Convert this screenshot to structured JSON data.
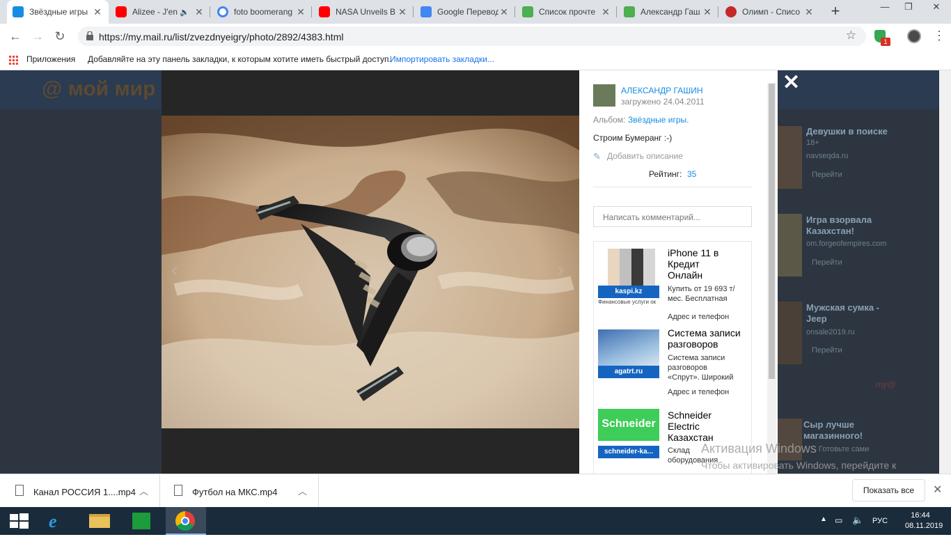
{
  "tabs": [
    {
      "title": "Звёздные игры",
      "favicon": "mail-ru",
      "active": true
    },
    {
      "title": "Alizee - J'en",
      "favicon": "youtube",
      "audio": true
    },
    {
      "title": "foto boomerang",
      "favicon": "google"
    },
    {
      "title": "NASA Unveils B",
      "favicon": "youtube"
    },
    {
      "title": "Google Перевод",
      "favicon": "google-translate"
    },
    {
      "title": "Список прочте",
      "favicon": "green-square"
    },
    {
      "title": "Александр Гаш",
      "favicon": "green-square"
    },
    {
      "title": "Олимп - Списо",
      "favicon": "olimp"
    }
  ],
  "toolbar": {
    "url": "https://my.mail.ru/list/zvezdnyeigry/photo/2892/4383.html",
    "badge": "1"
  },
  "bookmarks": {
    "apps_label": "Приложения",
    "hint": "Добавляйте на эту панель закладки, к которым хотите иметь быстрый доступ.",
    "import_link": "Импортировать закладки..."
  },
  "page": {
    "logo": "@ мой мир",
    "author": "АЛЕКСАНДР ГАШИН",
    "uploaded": "загружено 24.04.2011",
    "album_label": "Альбом:",
    "album_name": "Звёздные игры.",
    "caption": "Строим Бумеранг :-)",
    "add_description": "Добавить описание",
    "rating_label": "Рейтинг:",
    "rating_value": "35",
    "comment_placeholder": "Написать комментарий..."
  },
  "ads": [
    {
      "title": "iPhone 11 в Кредит Онлайн",
      "text": "Купить от 19 693 т/мес. Бесплатная",
      "address": "Адрес и телефон",
      "domain": "kaspi.kz",
      "subtext": "Финансовые услуги ок"
    },
    {
      "title": "Система записи разговоров",
      "text": "Система записи разговоров «Спрут». Широкий",
      "address": "Адрес и телефон",
      "domain": "agatrt.ru"
    },
    {
      "title": "Schneider Electric Казахстан",
      "text": "Склад оборудования",
      "domain": "schneider-ka..."
    }
  ],
  "right_ads": [
    {
      "title": "Девушки в поиске",
      "age": "18+",
      "domain": "navseqda.ru",
      "go": "Перейти"
    },
    {
      "title": "Игра взорвала Казахстан!",
      "domain": "om.forgeofempires.com",
      "go": "Перейти"
    },
    {
      "title": "Мужская сумка - Jeep",
      "domain": "onsale2019.ru",
      "go": "Перейти"
    },
    {
      "title": "Сыр лучше магазинного!",
      "extra": "Готовьте сами"
    }
  ],
  "watermark": {
    "title": "Активация Windows",
    "text": "Чтобы активировать Windows, перейдите к параметрам компьютера."
  },
  "downloads": {
    "items": [
      "Канал РОССИЯ 1....mp4",
      "Футбол на МКС.mp4"
    ],
    "show_all": "Показать все"
  },
  "taskbar": {
    "lang": "РУС",
    "time": "16:44",
    "date": "08.11.2019"
  }
}
